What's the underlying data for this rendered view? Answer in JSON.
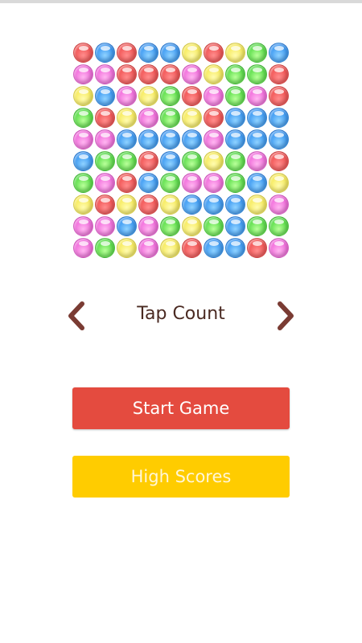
{
  "colors": {
    "start_button": "#e44b3f",
    "high_scores_button": "#ffcc00",
    "arrow": "#7a3b33",
    "mode_text": "#4a2a22"
  },
  "board": {
    "rows": [
      [
        "red",
        "blue",
        "red",
        "blue",
        "blue",
        "yellow",
        "red",
        "yellow",
        "green",
        "blue"
      ],
      [
        "pink",
        "pink",
        "red",
        "red",
        "red",
        "pink",
        "yellow",
        "green",
        "green",
        "red"
      ],
      [
        "yellow",
        "blue",
        "pink",
        "yellow",
        "green",
        "red",
        "pink",
        "green",
        "pink",
        "red"
      ],
      [
        "green",
        "red",
        "yellow",
        "pink",
        "green",
        "yellow",
        "red",
        "blue",
        "blue",
        "blue"
      ],
      [
        "pink",
        "pink",
        "blue",
        "blue",
        "blue",
        "blue",
        "pink",
        "blue",
        "blue",
        "blue"
      ],
      [
        "blue",
        "green",
        "green",
        "red",
        "blue",
        "green",
        "yellow",
        "green",
        "pink",
        "red"
      ],
      [
        "green",
        "pink",
        "red",
        "blue",
        "green",
        "pink",
        "pink",
        "green",
        "blue",
        "yellow"
      ],
      [
        "yellow",
        "red",
        "yellow",
        "red",
        "yellow",
        "blue",
        "blue",
        "blue",
        "yellow",
        "pink"
      ],
      [
        "pink",
        "pink",
        "blue",
        "pink",
        "green",
        "yellow",
        "green",
        "blue",
        "green",
        "green"
      ],
      [
        "pink",
        "green",
        "yellow",
        "pink",
        "yellow",
        "red",
        "blue",
        "blue",
        "red",
        "pink"
      ]
    ]
  },
  "mode_selector": {
    "label": "Tap Count",
    "prev_icon": "chevron-left-icon",
    "next_icon": "chevron-right-icon"
  },
  "buttons": {
    "start_label": "Start Game",
    "high_scores_label": "High Scores"
  }
}
